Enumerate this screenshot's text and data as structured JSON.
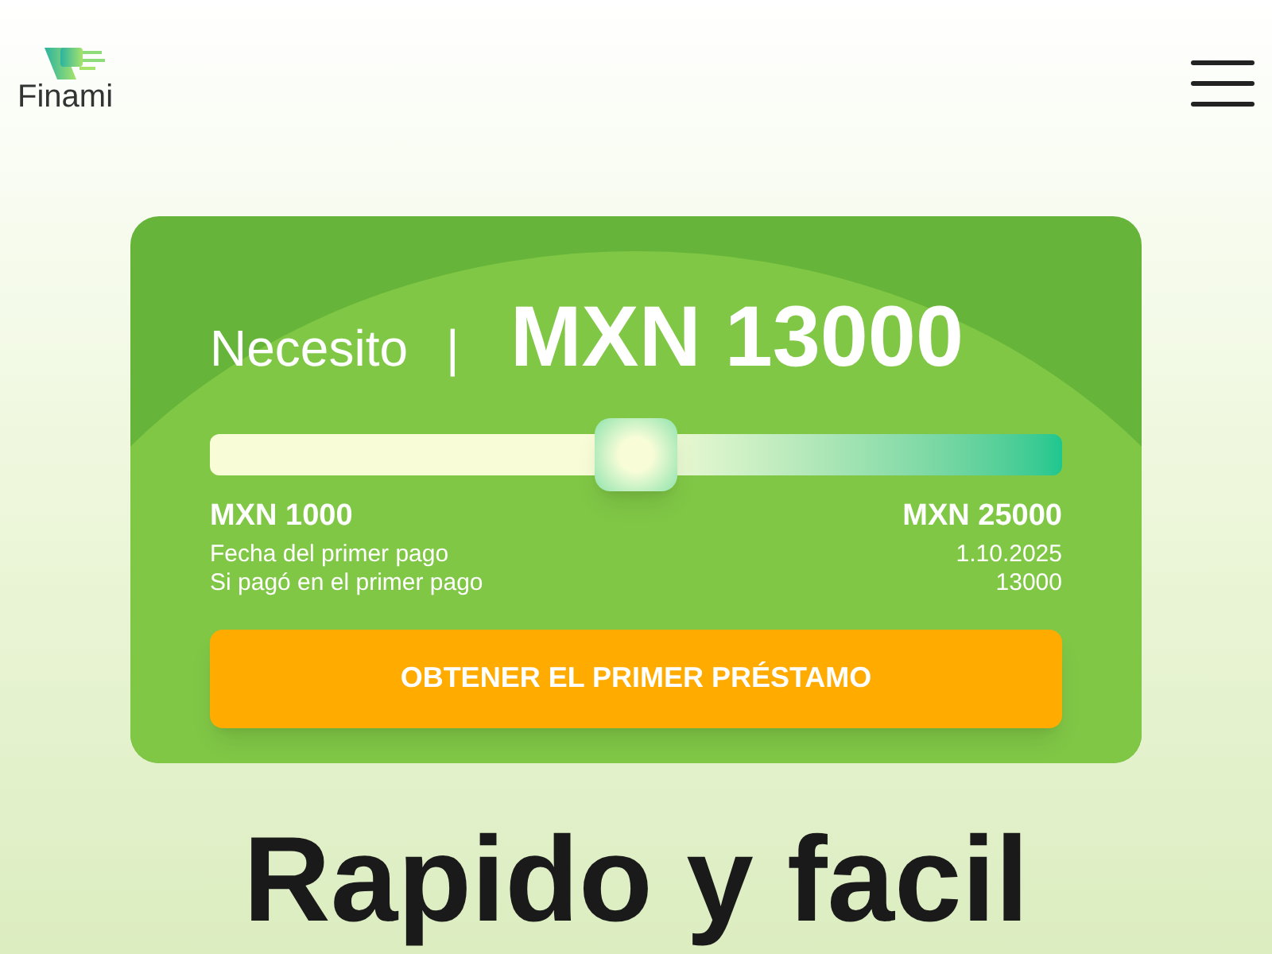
{
  "header": {
    "logo_text": "Finami"
  },
  "calculator": {
    "label": "Necesito",
    "separator": "|",
    "amount": "MXN 13000",
    "slider": {
      "level": 0.5
    },
    "min": "MXN 1000",
    "max": "MXN 25000",
    "details": [
      {
        "label": "Fecha del primer pago",
        "value": "1.10.2025"
      },
      {
        "label": "Si pagó en el primer pago",
        "value": "13000"
      }
    ],
    "button": "OBTENER EL PRIMER PRÉSTAMO"
  },
  "heading": "Rapido y facil"
}
